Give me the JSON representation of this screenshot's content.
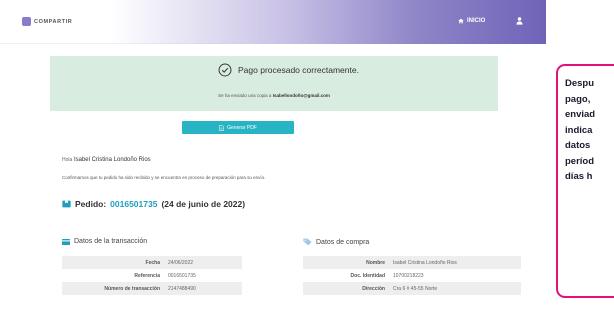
{
  "header": {
    "logo_text": "COMPARTIR",
    "nav_inicio": "INICIO",
    "accent_color": "#7a6fbf"
  },
  "banner": {
    "title": "Pago procesado correctamente.",
    "copy_prefix": "Se ha enviado una copia a",
    "copy_email": "Isabellondoño@gmail.com",
    "background": "#d8ece0"
  },
  "pdf_button": {
    "label": "Generar PDF",
    "color": "#29b4c6"
  },
  "greeting": {
    "hola": "Hola",
    "name": "Isabel Cristina Londoño Rios",
    "confirmation": "Confirmamos que tu pedido ha sido recibido y se encuentra en proceso de preparación para su envío."
  },
  "order": {
    "label": "Pedido:",
    "number": "0016501735",
    "date": "(24 de junio de 2022)"
  },
  "transaction": {
    "title": "Datos de la transacción",
    "rows": [
      {
        "key": "Fecha",
        "value": "24/06/2022"
      },
      {
        "key": "Referencia",
        "value": "0016501735"
      },
      {
        "key": "Número de transacción",
        "value": "2147488490"
      }
    ]
  },
  "purchase": {
    "title": "Datos de compra",
    "rows": [
      {
        "key": "Nombre",
        "value": "Isabel Cristina Londoño Rios"
      },
      {
        "key": "Doc. Identidad",
        "value": "10700218223"
      },
      {
        "key": "Dirección",
        "value": "Cra 6 # 45-55 Norte"
      }
    ]
  },
  "side_note": {
    "lines": [
      "Despu",
      "pago,",
      "enviad",
      "indica",
      "datos",
      "períod",
      "días h"
    ],
    "border_color": "#e2127a"
  }
}
